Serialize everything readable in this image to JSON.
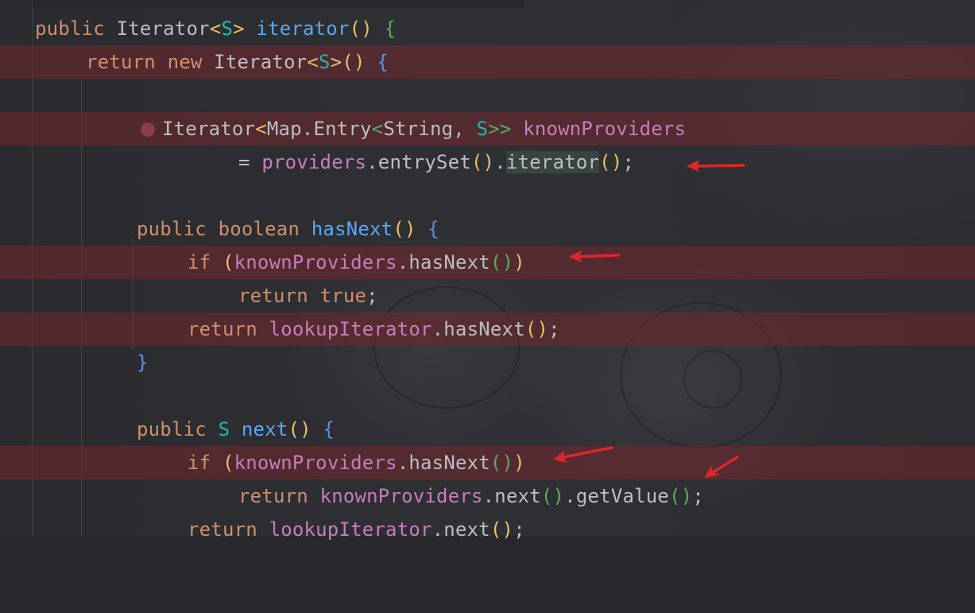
{
  "editor": {
    "lines": [
      {
        "tokens": [
          [
            "public",
            "kw"
          ],
          [
            " ",
            "pl"
          ],
          [
            "Iterator",
            "ty"
          ],
          [
            "<",
            "b1"
          ],
          [
            "S",
            "tp"
          ],
          [
            ">",
            "b1"
          ],
          [
            " ",
            "pl"
          ],
          [
            "iterator",
            "fn"
          ],
          [
            "()",
            "b1"
          ],
          [
            " ",
            "pl"
          ],
          [
            "{",
            "b2"
          ]
        ]
      },
      {
        "tokens": [
          [
            "return",
            "kw"
          ],
          [
            " ",
            "pl"
          ],
          [
            "new",
            "kw"
          ],
          [
            " ",
            "pl"
          ],
          [
            "Iterator",
            "ty"
          ],
          [
            "<",
            "b1"
          ],
          [
            "S",
            "tp"
          ],
          [
            ">",
            "b1"
          ],
          [
            "()",
            "b1"
          ],
          [
            " ",
            "pl"
          ],
          [
            "{",
            "b3"
          ]
        ]
      },
      {
        "tokens": []
      },
      {
        "tokens": [
          [
            "Iterator",
            "ty"
          ],
          [
            "<",
            "b1"
          ],
          [
            "Map.Entry",
            "ty"
          ],
          [
            "<",
            "b2"
          ],
          [
            "String, ",
            "ty"
          ],
          [
            "S",
            "tp"
          ],
          [
            ">>",
            "b2"
          ],
          [
            " ",
            "pl"
          ],
          [
            "knownProviders",
            "fd"
          ]
        ]
      },
      {
        "tokens": [
          [
            "= ",
            "pl"
          ],
          [
            "providers",
            "fd"
          ],
          [
            ".entrySet",
            "pl"
          ],
          [
            "()",
            "b1"
          ],
          [
            ".",
            "pl"
          ],
          [
            "iterator",
            "pl"
          ],
          [
            "()",
            "b1"
          ],
          [
            ";",
            "pl"
          ]
        ]
      },
      {
        "tokens": []
      },
      {
        "tokens": [
          [
            "public",
            "kw"
          ],
          [
            " ",
            "pl"
          ],
          [
            "boolean",
            "kw"
          ],
          [
            " ",
            "pl"
          ],
          [
            "hasNext",
            "fn"
          ],
          [
            "()",
            "b1"
          ],
          [
            " ",
            "pl"
          ],
          [
            "{",
            "b3"
          ]
        ]
      },
      {
        "tokens": [
          [
            "if",
            "kw"
          ],
          [
            " ",
            "pl"
          ],
          [
            "(",
            "b1"
          ],
          [
            "knownProviders",
            "fd"
          ],
          [
            ".hasNext",
            "pl"
          ],
          [
            "()",
            "b2"
          ],
          [
            ")",
            "b1"
          ]
        ]
      },
      {
        "tokens": [
          [
            "return",
            "kw"
          ],
          [
            " ",
            "pl"
          ],
          [
            "true",
            "kw"
          ],
          [
            ";",
            "pl"
          ]
        ]
      },
      {
        "tokens": [
          [
            "return",
            "kw"
          ],
          [
            " ",
            "pl"
          ],
          [
            "lookupIterator",
            "fd"
          ],
          [
            ".hasNext",
            "pl"
          ],
          [
            "()",
            "b1"
          ],
          [
            ";",
            "pl"
          ]
        ]
      },
      {
        "tokens": [
          [
            "}",
            "b3"
          ]
        ]
      },
      {
        "tokens": []
      },
      {
        "tokens": [
          [
            "public",
            "kw"
          ],
          [
            " ",
            "pl"
          ],
          [
            "S",
            "tp"
          ],
          [
            " ",
            "pl"
          ],
          [
            "next",
            "fn"
          ],
          [
            "()",
            "b1"
          ],
          [
            " ",
            "pl"
          ],
          [
            "{",
            "b3"
          ]
        ]
      },
      {
        "tokens": [
          [
            "if",
            "kw"
          ],
          [
            " ",
            "pl"
          ],
          [
            "(",
            "b1"
          ],
          [
            "knownProviders",
            "fd"
          ],
          [
            ".hasNext",
            "pl"
          ],
          [
            "()",
            "b2"
          ],
          [
            ")",
            "b1"
          ]
        ]
      },
      {
        "tokens": [
          [
            "return",
            "kw"
          ],
          [
            " ",
            "pl"
          ],
          [
            "knownProviders",
            "fd"
          ],
          [
            ".next",
            "pl"
          ],
          [
            "()",
            "b2"
          ],
          [
            ".getValue",
            "pl"
          ],
          [
            "()",
            "b2"
          ],
          [
            ";",
            "pl"
          ]
        ]
      },
      {
        "tokens": [
          [
            "return",
            "kw"
          ],
          [
            " ",
            "pl"
          ],
          [
            "lookupIterator",
            "fd"
          ],
          [
            ".next",
            "pl"
          ],
          [
            "()",
            "b1"
          ],
          [
            ";",
            "pl"
          ]
        ]
      }
    ],
    "colors": {
      "background": "#27292c",
      "keyword": "#cf8e6d",
      "type": "#bcbec4",
      "type_param": "#16baac",
      "method_decl": "#56a8f5",
      "field": "#c77dbb",
      "highlight_row": "#73282d",
      "arrow": "#e0262a"
    },
    "icons": [
      "breakpoint-icon",
      "red-arrow-icon"
    ]
  }
}
